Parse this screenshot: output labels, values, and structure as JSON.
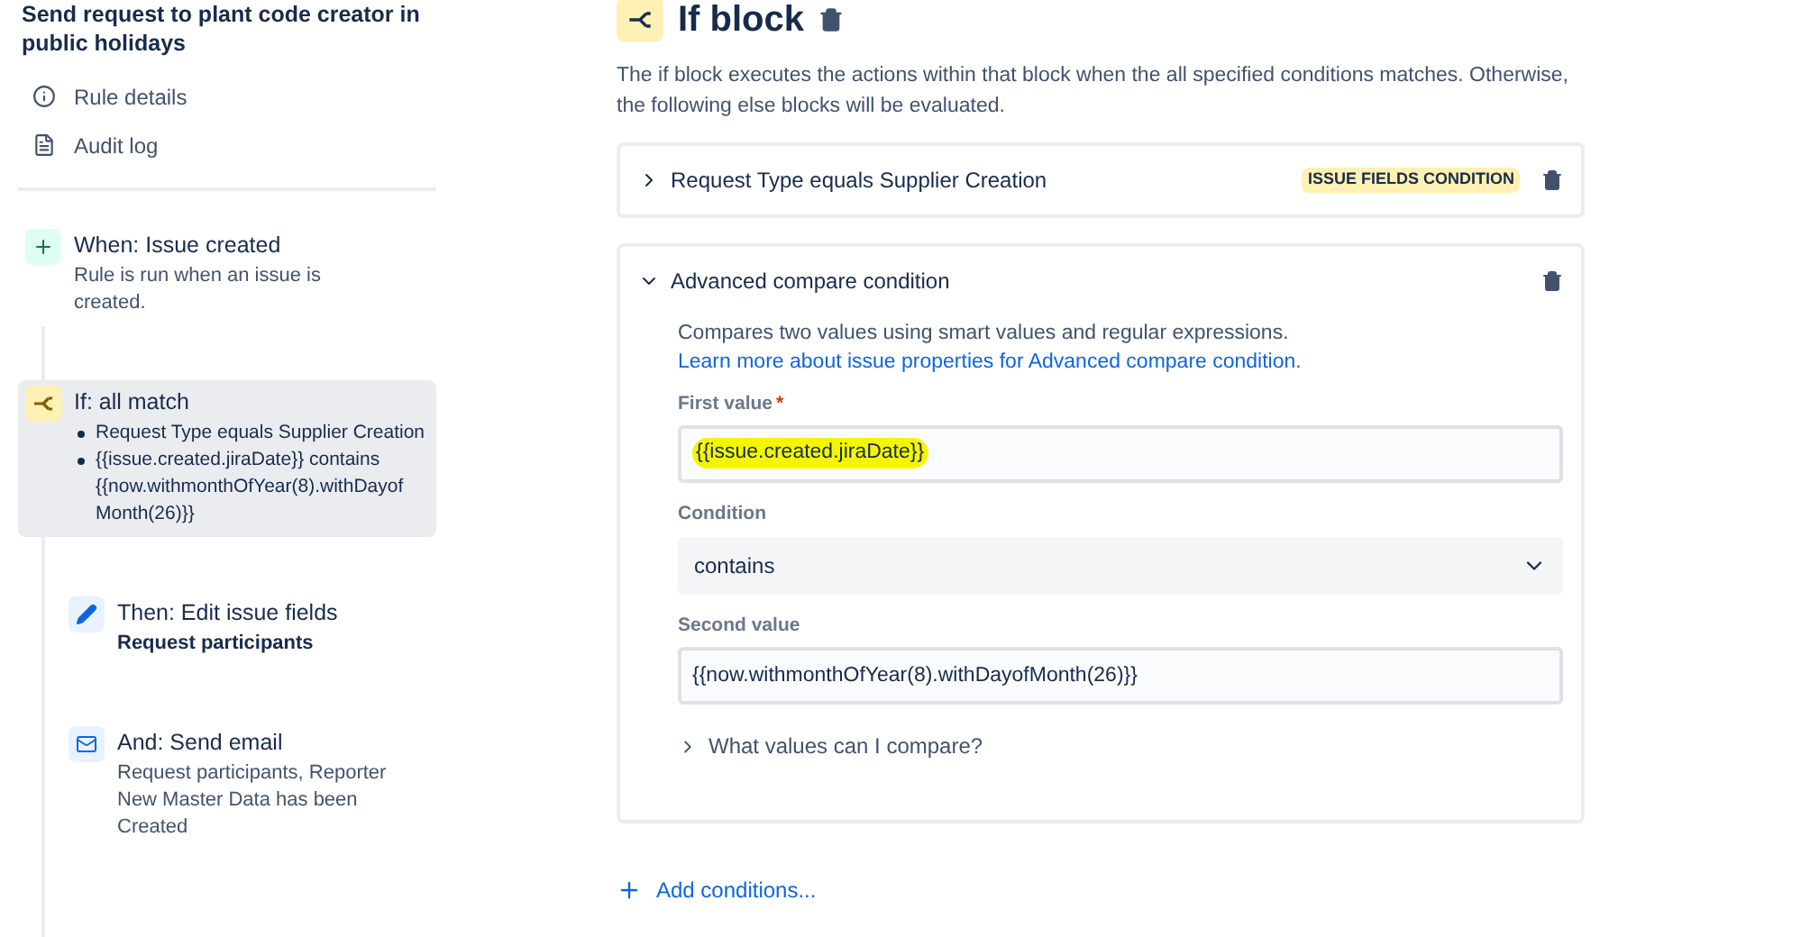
{
  "sidebar": {
    "rule_title": "Send request to plant code creator in public holidays",
    "links": [
      {
        "kind": "info",
        "label": "Rule details"
      },
      {
        "kind": "log",
        "label": "Audit log"
      }
    ],
    "steps": [
      {
        "kind": "trigger",
        "title": "When: Issue created",
        "selected": false,
        "lines": [
          "Rule is run when an issue is created."
        ]
      },
      {
        "kind": "condition",
        "title": "If: all match",
        "selected": true,
        "bullets": [
          "Request Type equals Supplier Creation",
          "{{issue.created.jiraDate}} contains {{now.withmonthOfYear(8).withDayof Month(26)}}"
        ]
      },
      {
        "kind": "edit",
        "title": "Then: Edit issue fields",
        "selected": false,
        "bold_line": "Request participants"
      },
      {
        "kind": "email",
        "title": "And: Send email",
        "selected": false,
        "lines": [
          "Request participants, Reporter",
          "New Master Data has been Created"
        ]
      }
    ]
  },
  "main": {
    "heading": "If block",
    "description": "The if block executes the actions within that block when the all specified conditions matches. Otherwise, the following else blocks will be evaluated.",
    "conditions": [
      {
        "title": "Request Type equals Supplier Creation",
        "expanded": false,
        "badge": "ISSUE FIELDS CONDITION"
      },
      {
        "title": "Advanced compare condition",
        "expanded": true,
        "intro": "Compares two values using smart values and regular expressions.",
        "link": "Learn more about issue properties for Advanced compare condition.",
        "first_label": "First value",
        "required_mark": "*",
        "first_value": "{{issue.created.jiraDate}}",
        "first_highlighted": true,
        "condition_label": "Condition",
        "condition_value": "contains",
        "second_label": "Second value",
        "second_value": "{{now.withmonthOfYear(8).withDayofMonth(26)}}",
        "help_toggle": "What values can I compare?",
        "help_expanded": false
      }
    ],
    "add_label": "Add conditions..."
  }
}
